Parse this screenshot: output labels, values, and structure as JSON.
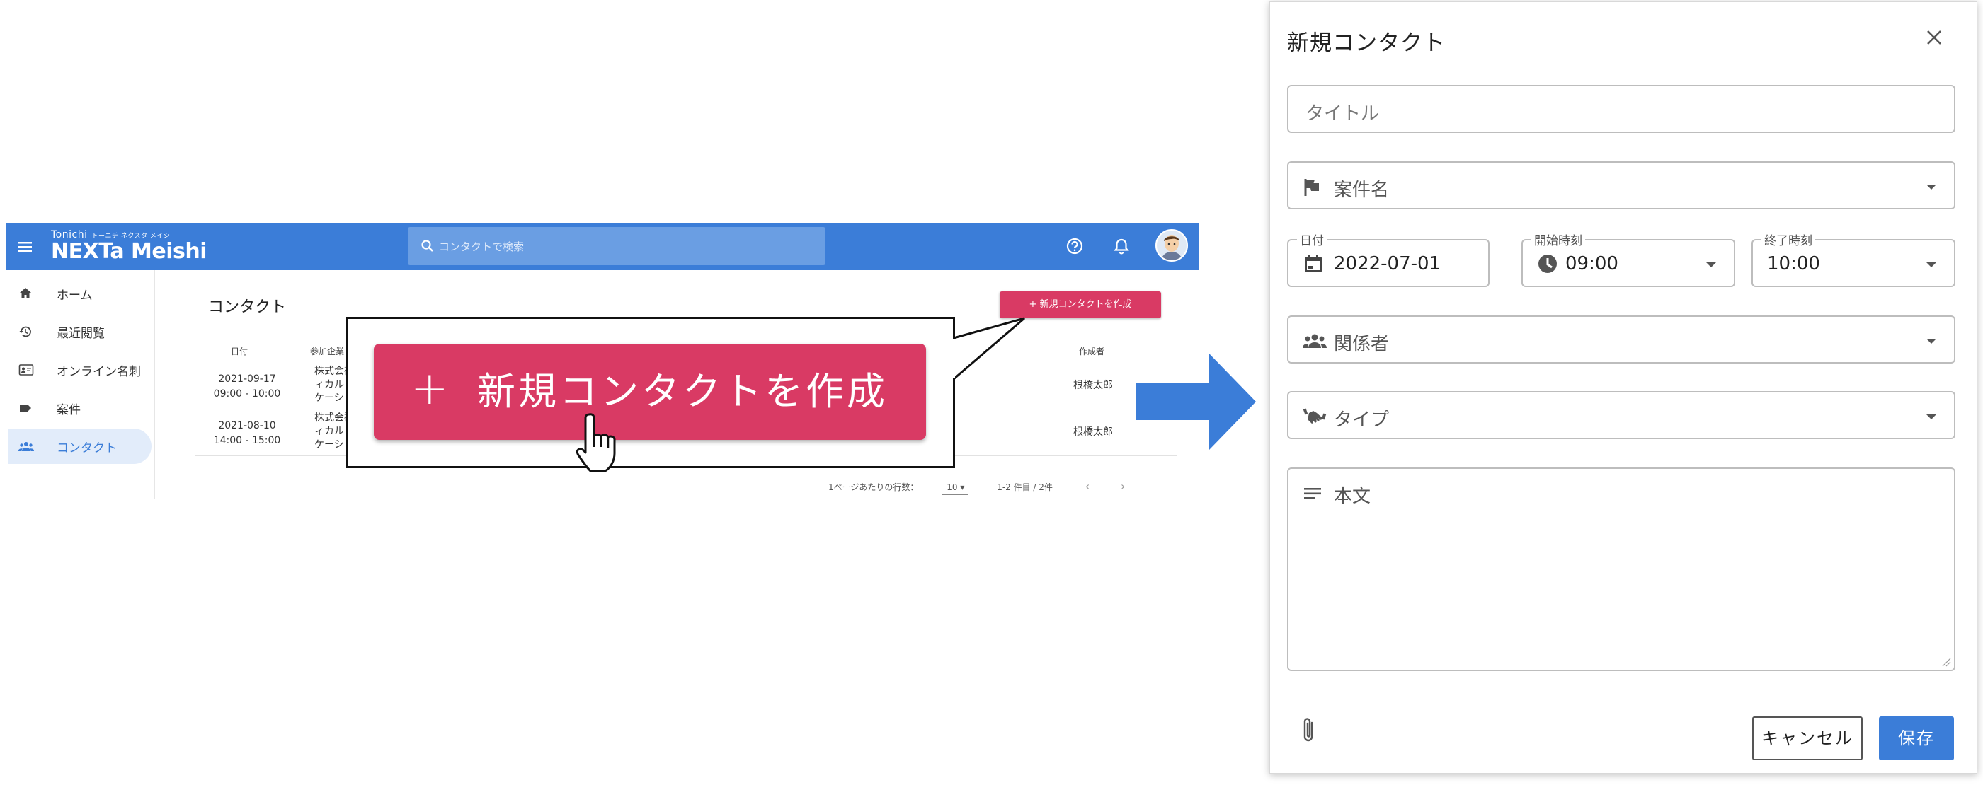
{
  "app": {
    "brand_small": "Tonichi",
    "brand_small_kana": "トーニチ ネクスタ メイシ",
    "brand_big": "NEXTa Meishi",
    "search_placeholder": "コンタクトで検索",
    "sidebar": {
      "items": [
        {
          "label": "ホーム",
          "icon": "home-icon"
        },
        {
          "label": "最近閲覧",
          "icon": "history-icon"
        },
        {
          "label": "オンライン名刺",
          "icon": "card-icon"
        },
        {
          "label": "案件",
          "icon": "label-icon"
        },
        {
          "label": "コンタクト",
          "icon": "people-icon",
          "active": true
        }
      ]
    },
    "content_title": "コンタクト",
    "new_button_small": "+ 新規コンタクトを作成",
    "table": {
      "headers": {
        "date": "日付",
        "company": "参加企業",
        "author": "作成者"
      },
      "rows": [
        {
          "date": "2021-09-17",
          "time": "09:00 - 10:00",
          "company_1": "株式会社",
          "company_2": "ィカル",
          "company_3": "ケーシ",
          "author": "根橋太郎"
        },
        {
          "date": "2021-08-10",
          "time": "14:00 - 15:00",
          "company_1": "株式会社",
          "company_2": "ィカル",
          "company_3": "ケーシ",
          "author": "根橋太郎"
        }
      ]
    },
    "pager": {
      "rows_label": "1ページあたりの行数：",
      "rows_value": "10",
      "range": "1-2 件目 / 2件"
    }
  },
  "callout": {
    "plus": "+",
    "label": "新規コンタクトを作成"
  },
  "dialog": {
    "title": "新規コンタクト",
    "title_placeholder": "タイトル",
    "project_label": "案件名",
    "date_label": "日付",
    "date_value": "2022-07-01",
    "start_label": "開始時刻",
    "start_value": "09:00",
    "end_label": "終了時刻",
    "end_value": "10:00",
    "participants_label": "関係者",
    "type_label": "タイプ",
    "body_label": "本文",
    "cancel": "キャンセル",
    "save": "保存"
  },
  "colors": {
    "primary": "#3b7dd8",
    "accent": "#d93a64"
  }
}
